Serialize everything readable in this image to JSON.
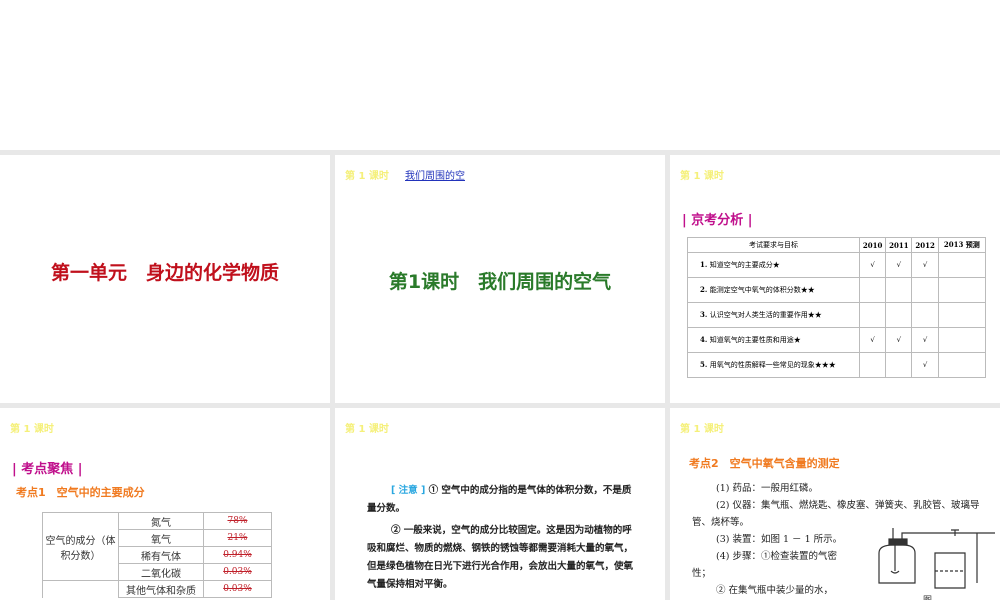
{
  "slides": [
    {
      "title": "第一单元　身边的化学物质",
      "title_color": "#c0101c"
    },
    {
      "header": "第 1 课时",
      "link": "我们周围的空",
      "title": "第1课时　我们周围的空气",
      "title_color": "#2a7a2a"
    },
    {
      "header": "第 1 课时",
      "section": "| 京考分析 |",
      "table": {
        "headers": [
          "考试要求与目标",
          "2010",
          "2011",
          "2012",
          "2013 预测"
        ],
        "rows": [
          {
            "num": "1.",
            "text": "知道空气的主要成分★",
            "marks": [
              "√",
              "√",
              "√",
              ""
            ]
          },
          {
            "num": "2.",
            "text": "能测定空气中氧气的体积分数★★",
            "marks": [
              "",
              "",
              "",
              ""
            ]
          },
          {
            "num": "3.",
            "text": "认识空气对人类生活的重要作用★★",
            "marks": [
              "",
              "",
              "",
              ""
            ]
          },
          {
            "num": "4.",
            "text": "知道氧气的主要性质和用途★",
            "marks": [
              "√",
              "√",
              "√",
              ""
            ]
          },
          {
            "num": "5.",
            "text": "用氧气的性质解释一些常见的现象★★★",
            "marks": [
              "",
              "",
              "√",
              ""
            ]
          }
        ]
      }
    },
    {
      "header": "第 1 课时",
      "section": "| 考点聚焦 |",
      "subtitle": "考点1　空气中的主要成分",
      "table": {
        "label": "空气的成分（体积分数）",
        "rows": [
          {
            "name": "氮气",
            "value": "78%"
          },
          {
            "name": "氧气",
            "value": "21%"
          },
          {
            "name": "稀有气体",
            "value": "0.94%"
          },
          {
            "name": "二氧化碳",
            "value": "0.03%"
          },
          {
            "name": "其他气体和杂质",
            "value": "0.03%"
          }
        ]
      }
    },
    {
      "header": "第 1 课时",
      "note_label": "[ 注意 ]",
      "p1": "① 空气中的成分指的是气体的体积分数，不是质量分数。",
      "p2": "② 一般来说，空气的成分比较固定。这是因为动植物的呼吸和腐烂、物质的燃烧、钢铁的锈蚀等都需要消耗大量的氧气，但是绿色植物在日光下进行光合作用，会放出大量的氧气，使氧气量保持相对平衡。"
    },
    {
      "header": "第 1 课时",
      "subtitle": "考点2　空气中氧气含量的测定",
      "lines": [
        "(1) 药品：一般用红磷。",
        "(2) 仪器：集气瓶、燃烧匙、橡皮塞、弹簧夹、乳胶管、玻璃导管、烧杯等。",
        "(3) 装置：如图 1 － 1 所示。",
        "(4) 步骤：①检查装置的气密性；",
        "② 在集气瓶中装少量的水，"
      ],
      "figure_label": "图"
    }
  ]
}
